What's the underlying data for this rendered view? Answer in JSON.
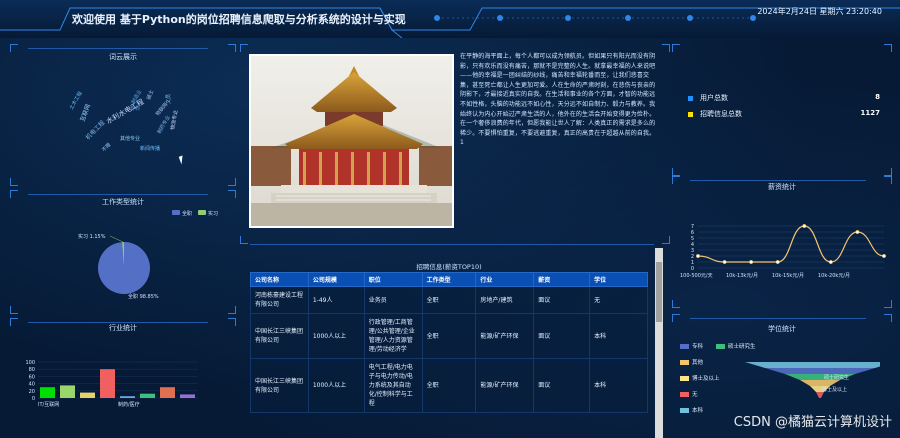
{
  "header": {
    "title": "欢迎使用 基于Python的岗位招聘信息爬取与分析系统的设计与实现",
    "datetime": "2024年2月24日 星期六 23:20:40"
  },
  "panels": {
    "wordcloud_title": "词云展示",
    "jobtype_title": "工作类型统计",
    "industry_title": "行业统计",
    "salary_title": "薪资统计",
    "education_title": "学位统计",
    "table_title": "招聘信息(薪资TOP10)"
  },
  "wordcloud": {
    "words": [
      "互联网",
      "土木工程",
      "机电工程",
      "水利水电工程",
      "制造业",
      "物联网",
      "其他专业",
      "不限",
      "新闻传播",
      "制药专业",
      "物流专业",
      "专科",
      "硕士",
      "文员"
    ]
  },
  "article": {
    "text": "在平静的海平面上，每个人都可以成为领航员。但如果只有阳光而没有阴影，只有欢乐而没有痛苦，那就不是完整的人生。就拿最幸福的人来说吧——他的幸福是一团纠结的纱线，痛苦和幸福轮番而至，让我们悲喜交集，甚至死亡都让人生更加可爱。人在生命的严肃时刻，在悲伤与丧亲的阴影下，才最接近真实的自我。在生活和事业的各个方面，才智的功能远不如性格，头脑的功能远不如心性，天分远不如自制力、毅力与教养。我始终认为内心开始过严肃生活的人，他外在的生活会开始变得更为俭朴。在一个奢侈浪费的年代，但愿我能让世人了解：人类真正的需求是多么的稀少。不要惧怕重复，不要逃避重复，真正的高贵在于超越从前的自我。1"
  },
  "stats": {
    "users_label": "用户总数",
    "users_value": "8",
    "jobs_label": "招聘信息总数",
    "jobs_value": "1127",
    "users_color": "#1e90ff",
    "jobs_color": "#ffe000"
  },
  "table": {
    "headers": [
      "公司名称",
      "公司规模",
      "职位",
      "工作类型",
      "行业",
      "薪资",
      "学位"
    ],
    "rows": [
      [
        "河南栋豪建设工程有限公司",
        "1-49人",
        "业务员",
        "全职",
        "房地产/建筑",
        "面议",
        "无"
      ],
      [
        "中国长江三峡集团有限公司",
        "1000人以上",
        "行政管理/工商管理/公共管理/企业管理/人力资源管理/劳动经济学",
        "全职",
        "能源/矿产环保",
        "面议",
        "本科"
      ],
      [
        "中国长江三峡集团有限公司",
        "1000人以上",
        "电气工程/电力电子与电力传动/电力系统及其自动化/控制科学与工程",
        "全职",
        "能源/矿产环保",
        "面议",
        "本科"
      ]
    ]
  },
  "chart_data": [
    {
      "type": "pie",
      "labels": [
        "全职",
        "实习"
      ],
      "values": [
        98.85,
        1.15
      ],
      "data_labels": [
        "全职 98.85%",
        "实习 1.15%"
      ],
      "colors": [
        "#5470c6",
        "#91cc75"
      ],
      "legend": [
        "全职",
        "实习"
      ],
      "legend_position": "top-right"
    },
    {
      "type": "bar",
      "categories": [
        "IT/互联网",
        "",
        "",
        "",
        "制药/医疗",
        "",
        "",
        ""
      ],
      "tick_labels": [
        "IT/互联网",
        "制药/医疗"
      ],
      "values": [
        30,
        35,
        15,
        80,
        5,
        12,
        30,
        10
      ],
      "colors": [
        "#00e000",
        "#9ad66b",
        "#e8d36a",
        "#f06060",
        "#6ea8e0",
        "#3fbf7f",
        "#e07050",
        "#9a6fd0"
      ],
      "yticks": [
        "0",
        "20",
        "40",
        "60",
        "80",
        "100"
      ],
      "ylim": [
        0,
        100
      ]
    },
    {
      "type": "line",
      "categories": [
        "100-500元/天",
        "10k-13k元/月",
        "10k-15k元/月",
        "10k-20k元/月",
        ""
      ],
      "x_tick_labels": [
        "100-500元/天",
        "10k-13k元/月",
        "10k-15k元/月",
        "10k-20k元/月"
      ],
      "values": [
        2,
        1,
        1,
        1,
        7,
        1,
        6,
        2
      ],
      "yticks": [
        "0",
        "1",
        "2",
        "3",
        "4",
        "5",
        "6",
        "7"
      ],
      "ylim": [
        0,
        7
      ],
      "color": "#f3c56b"
    },
    {
      "type": "funnel",
      "labels": [
        "专科",
        "硕士研究生",
        "其他",
        "博士及以上",
        "无",
        "本科"
      ],
      "visible_labels": [
        "硕士研究生",
        "博士及以上"
      ],
      "colors": [
        "#5470c6",
        "#3fbf7f",
        "#f3c56b",
        "#ffe38a",
        "#f06060",
        "#73c0de"
      ]
    }
  ],
  "watermark": "CSDN @橘猫云计算机设计"
}
